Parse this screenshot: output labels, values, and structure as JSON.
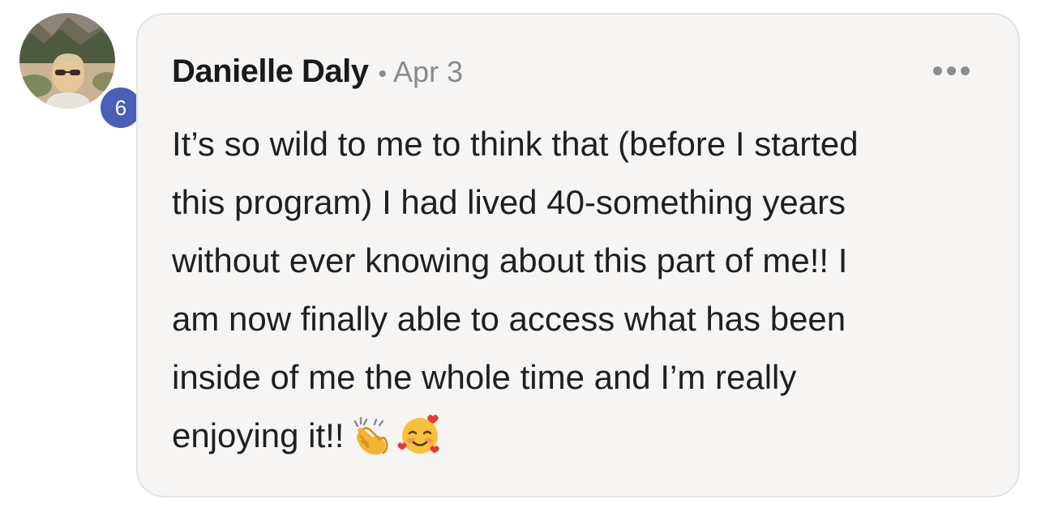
{
  "comment": {
    "author": "Danielle Daly",
    "separator": "•",
    "date": "Apr 3",
    "badge_count": "6",
    "more_icon": "more-horizontal-icon",
    "lines": [
      "It’s so wild to me to think that (before I started",
      "this program) I had lived 40-something years",
      "without ever knowing about this part of me!! I",
      "am now finally able to access what has been",
      "inside of me the whole time and I’m really",
      "enjoying it!!"
    ],
    "emojis": [
      "clapping-hands-emoji",
      "smiling-face-with-hearts-emoji"
    ]
  },
  "colors": {
    "bubble_bg": "#f6f5f4",
    "badge_bg": "#4a5fb8",
    "muted_text": "#8a8a8a",
    "main_text": "#1f1f1f"
  }
}
